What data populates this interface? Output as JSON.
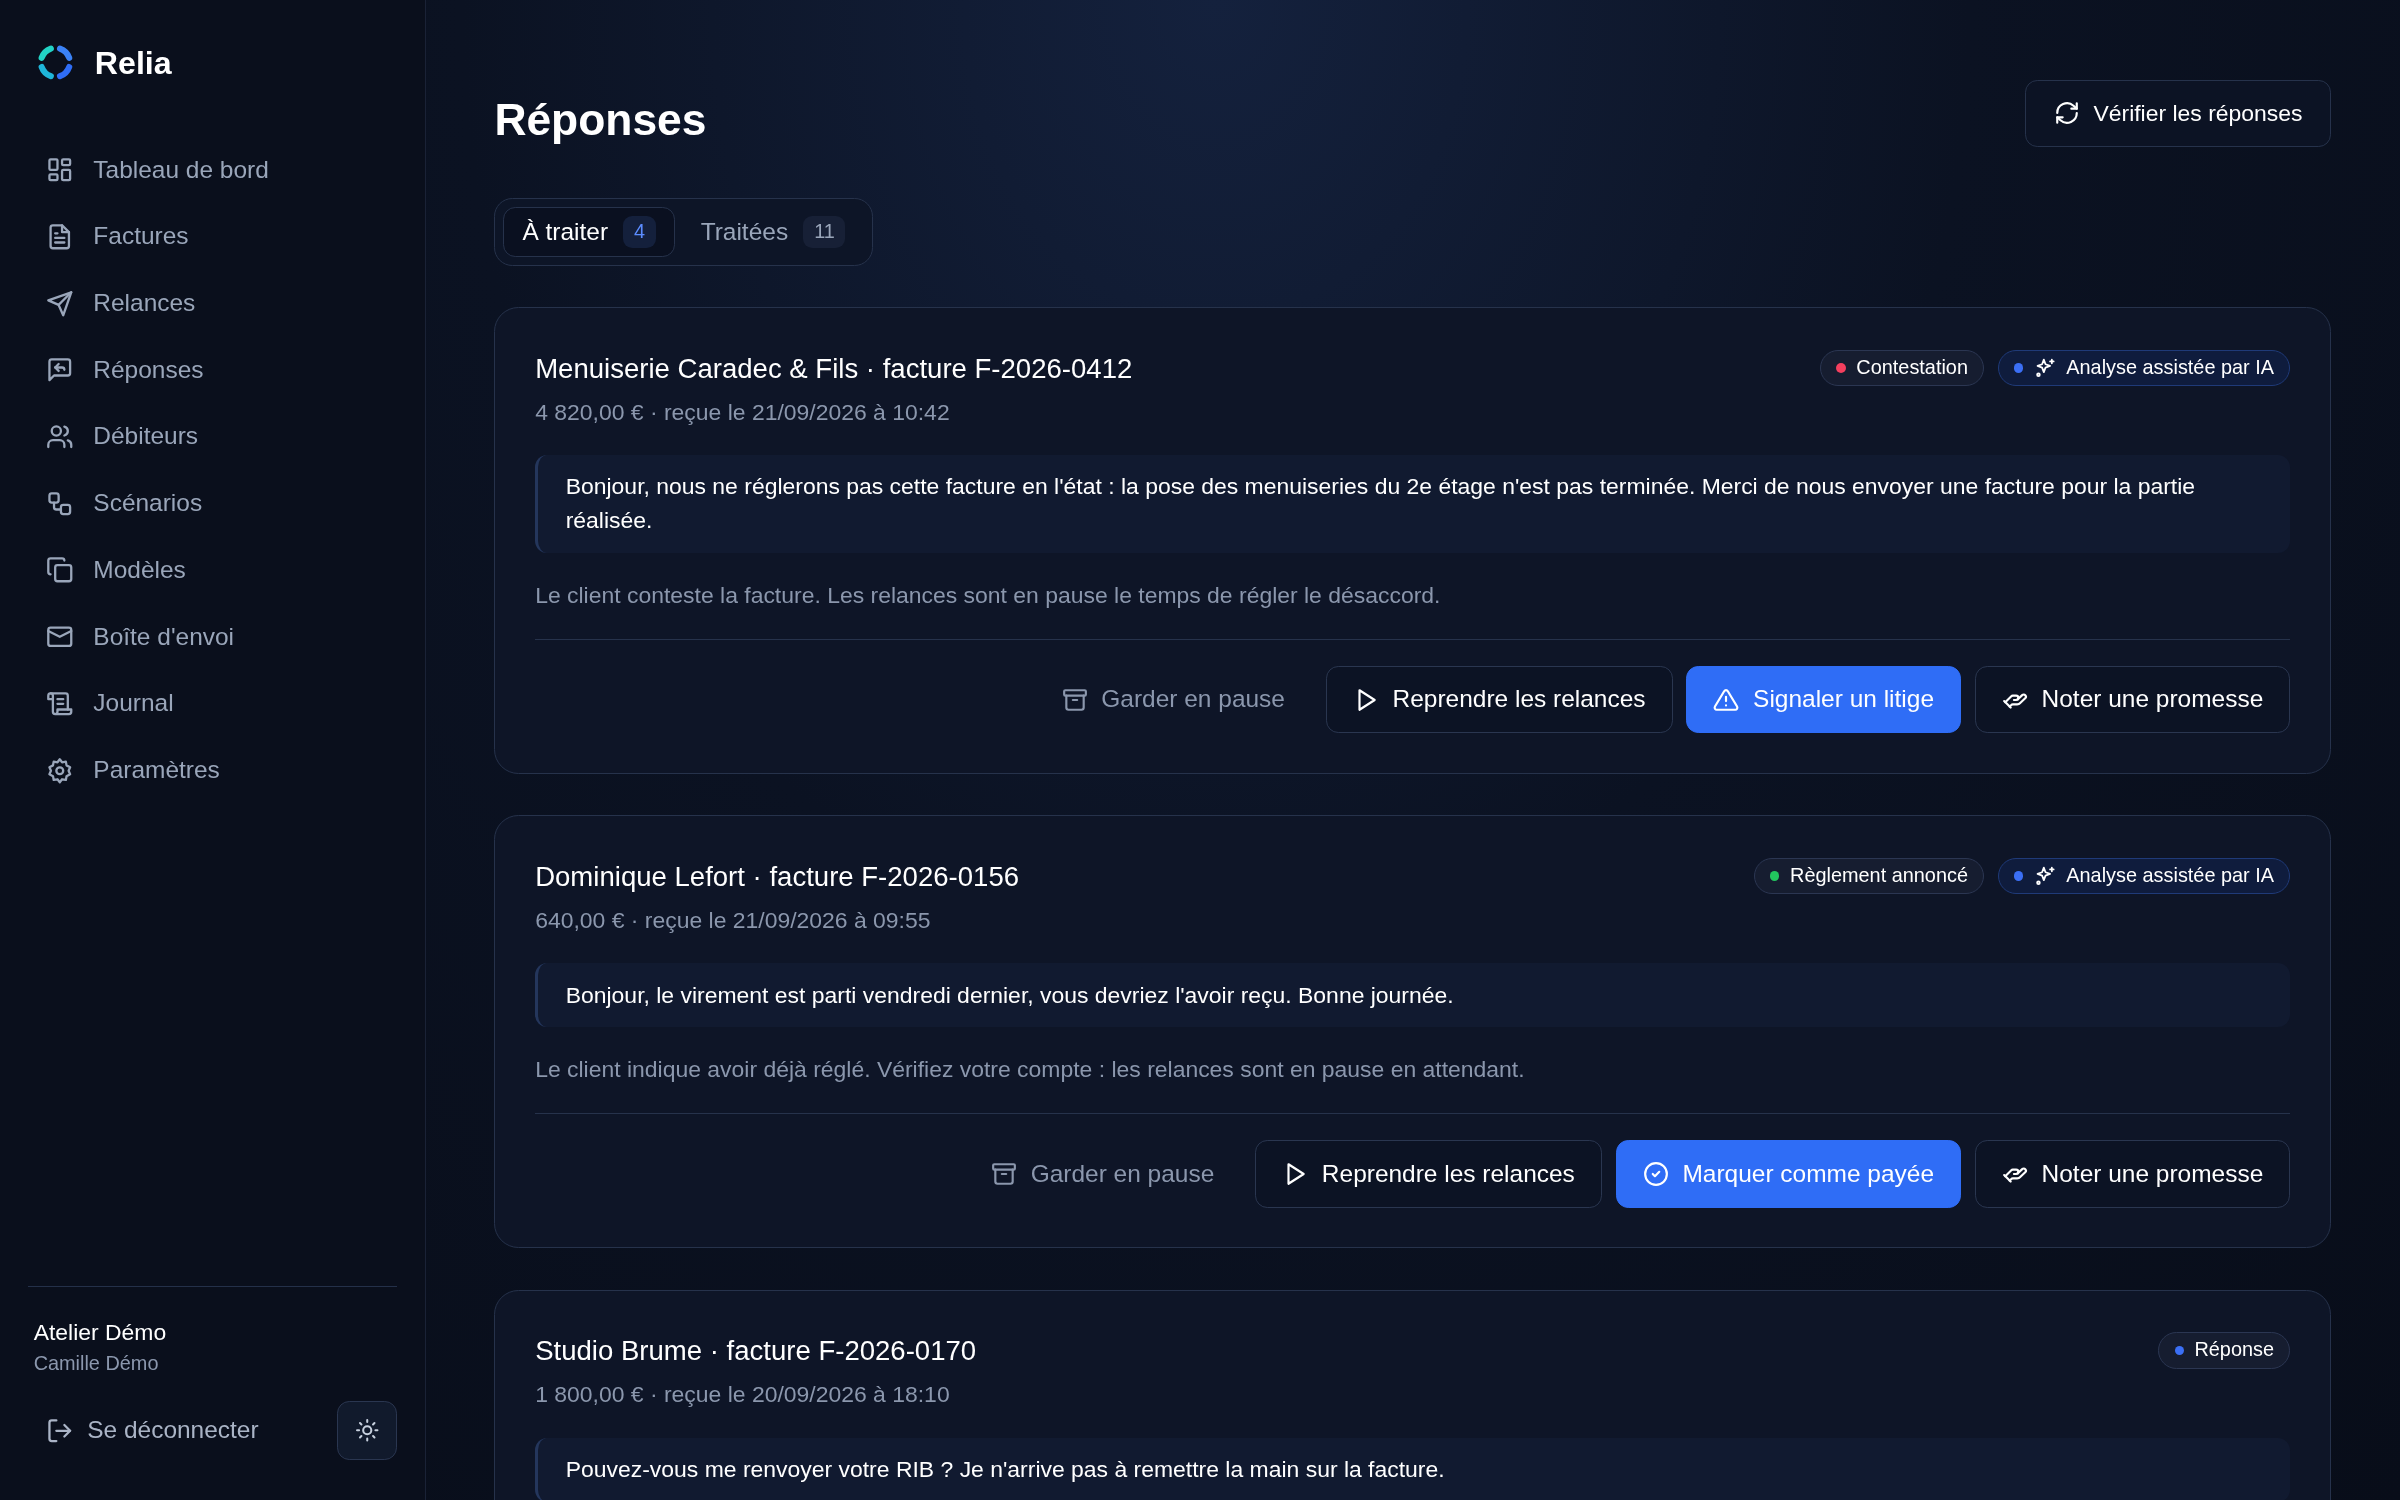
{
  "app": {
    "name": "Relia"
  },
  "sidebar": {
    "items": [
      {
        "label": "Tableau de bord",
        "selected": false
      },
      {
        "label": "Factures",
        "selected": false
      },
      {
        "label": "Relances",
        "selected": false
      },
      {
        "label": "Réponses",
        "selected": false
      },
      {
        "label": "Débiteurs",
        "selected": false
      },
      {
        "label": "Scénarios",
        "selected": false
      },
      {
        "label": "Modèles",
        "selected": false
      },
      {
        "label": "Boîte d'envoi",
        "selected": false
      },
      {
        "label": "Journal",
        "selected": false
      },
      {
        "label": "Paramètres",
        "selected": false
      }
    ]
  },
  "account": {
    "company": "Atelier Démo",
    "user": "Camille Démo",
    "logout": "Se déconnecter"
  },
  "page": {
    "title": "Réponses",
    "action": "Vérifier les réponses"
  },
  "tabs": [
    {
      "label": "À traiter",
      "count": "4",
      "selected": true
    },
    {
      "label": "Traitées",
      "count": "11",
      "selected": false
    }
  ],
  "responses": [
    {
      "title": "Menuiserie Caradec & Fils · facture F-2026-0412",
      "meta": "4 820,00 € · reçue le 21/09/2026 à 10:42",
      "badges": [
        {
          "label": "Contestation",
          "kind": "status",
          "color": "#f43f5e"
        },
        {
          "label": "Analyse assistée par IA",
          "kind": "ai",
          "color": "#3b6ff5"
        }
      ],
      "message": "Bonjour, nous ne réglerons pas cette facture en l'état : la pose des menuiseries du 2e étage n'est pas terminée. Merci de nous envoyer une facture pour la partie réalisée.",
      "summary": "Le client conteste la facture. Les relances sont en pause le temps de régler le désaccord.",
      "actions": [
        {
          "label": "Garder en pause",
          "kind": "pause"
        },
        {
          "label": "Reprendre les relances",
          "kind": "resume"
        },
        {
          "label": "Signaler un litige",
          "kind": "dispute"
        },
        {
          "label": "Noter une promesse",
          "kind": "promise"
        }
      ]
    },
    {
      "title": "Dominique Lefort · facture F-2026-0156",
      "meta": "640,00 € · reçue le 21/09/2026 à 09:55",
      "badges": [
        {
          "label": "Règlement annoncé",
          "kind": "status",
          "color": "#22c55e"
        },
        {
          "label": "Analyse assistée par IA",
          "kind": "ai",
          "color": "#3b6ff5"
        }
      ],
      "message": "Bonjour, le virement est parti vendredi dernier, vous devriez l'avoir reçu. Bonne journée.",
      "summary": "Le client indique avoir déjà réglé. Vérifiez votre compte : les relances sont en pause en attendant.",
      "actions": [
        {
          "label": "Garder en pause",
          "kind": "pause"
        },
        {
          "label": "Reprendre les relances",
          "kind": "resume"
        },
        {
          "label": "Marquer comme payée",
          "kind": "paid"
        },
        {
          "label": "Noter une promesse",
          "kind": "promise"
        }
      ]
    },
    {
      "title": "Studio Brume · facture F-2026-0170",
      "meta": "1 800,00 € · reçue le 20/09/2026 à 18:10",
      "badges": [
        {
          "label": "Réponse",
          "kind": "status",
          "color": "#3b6ff5"
        }
      ],
      "message": "Pouvez-vous me renvoyer votre RIB ? Je n'arrive pas à remettre la main sur la facture."
    }
  ]
}
